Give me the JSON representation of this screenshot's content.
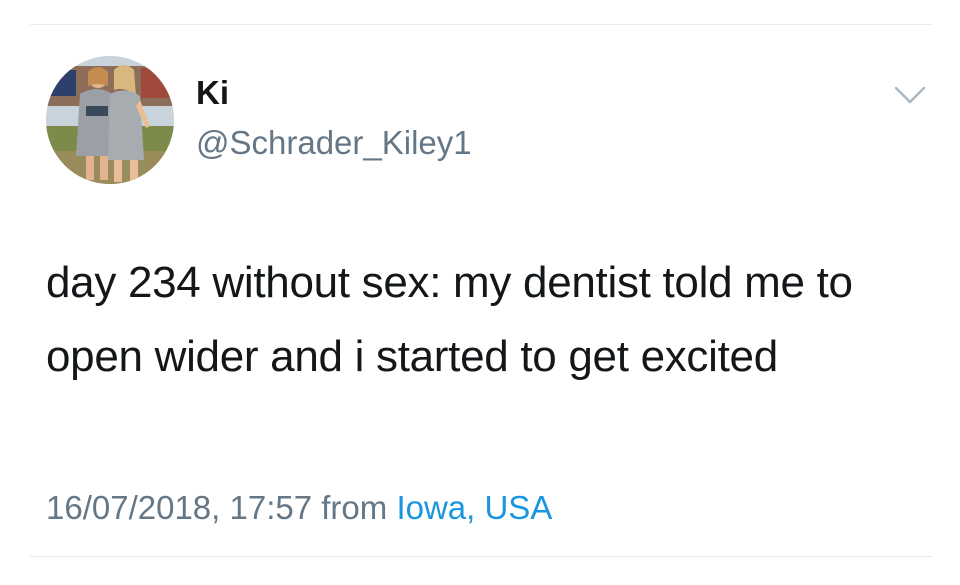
{
  "tweet": {
    "author": {
      "display_name": "Ki",
      "handle": "@Schrader_Kiley1",
      "avatar": "profile-photo-two-people"
    },
    "menu_icon": "chevron-down-icon",
    "text": "day 234 without sex: my dentist told me to open wider and i started to get excited",
    "timestamp": "16/07/2018, 17:57",
    "from_label": "from",
    "location": "Iowa, USA"
  },
  "colors": {
    "text_primary": "#14171a",
    "text_secondary": "#657786",
    "link": "#1b95e0",
    "divider": "#e6ecf0"
  }
}
